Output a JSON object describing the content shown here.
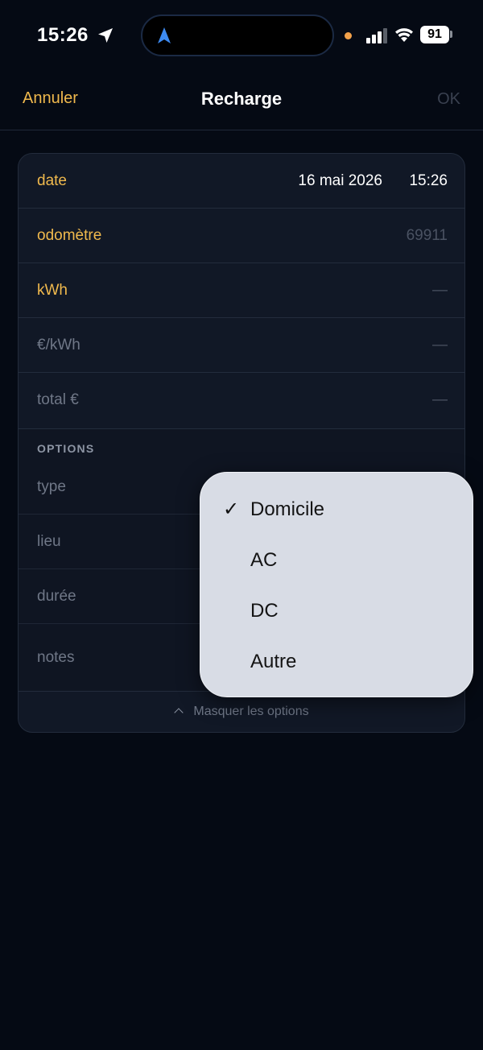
{
  "status_bar": {
    "time": "15:26",
    "battery": "91"
  },
  "nav": {
    "cancel": "Annuler",
    "title": "Recharge",
    "ok": "OK"
  },
  "form": {
    "date": {
      "label": "date",
      "day": "16 mai 2026",
      "time": "15:26"
    },
    "odometer": {
      "label": "odomètre",
      "value": "69911"
    },
    "kwh": {
      "label": "kWh",
      "value": "—"
    },
    "price_per_kwh": {
      "label": "€/kWh",
      "value": "—"
    },
    "total": {
      "label": "total €",
      "value": "—"
    }
  },
  "options": {
    "header": "OPTIONS",
    "type_label": "type",
    "location_label": "lieu",
    "duration_label": "durée",
    "notes_label": "notes",
    "toggle": "Masquer les options"
  },
  "type_menu": {
    "check_glyph": "✓",
    "items": [
      {
        "label": "Domicile",
        "selected": true
      },
      {
        "label": "AC",
        "selected": false
      },
      {
        "label": "DC",
        "selected": false
      },
      {
        "label": "Autre",
        "selected": false
      }
    ]
  },
  "colors": {
    "accent": "#f0b94d",
    "background": "#050a14",
    "card": "#111826",
    "menu": "#d8dce5"
  }
}
